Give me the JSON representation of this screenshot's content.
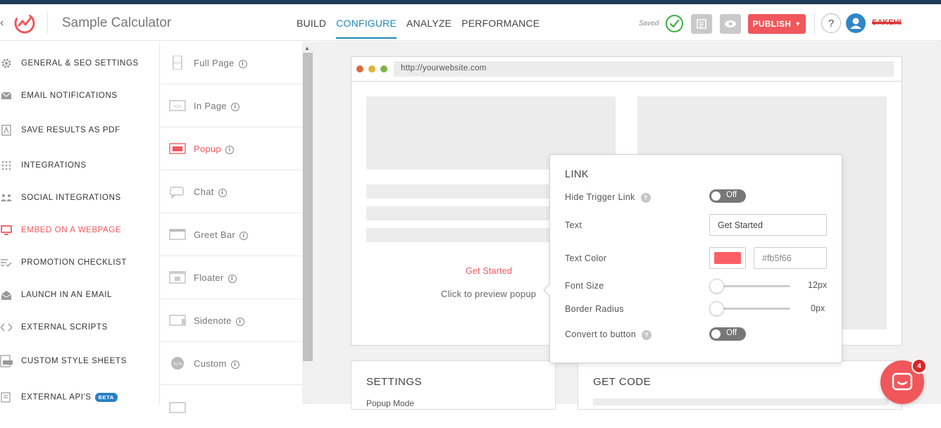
{
  "header": {
    "app_title": "Sample Calculator",
    "nav": [
      "BUILD",
      "CONFIGURE",
      "ANALYZE",
      "PERFORMANCE"
    ],
    "active_nav": "CONFIGURE",
    "saved_text": "Saved",
    "publish_label": "PUBLISH",
    "help_label": "?",
    "username": "SAKSHI"
  },
  "sidebar": {
    "items": [
      {
        "label": "GENERAL & SEO SETTINGS",
        "icon": "gear-icon"
      },
      {
        "label": "EMAIL NOTIFICATIONS",
        "icon": "envelope-icon"
      },
      {
        "label": "SAVE RESULTS AS PDF",
        "icon": "pdf-icon"
      },
      {
        "label": "INTEGRATIONS",
        "icon": "grid-dots-icon"
      },
      {
        "label": "SOCIAL INTEGRATIONS",
        "icon": "people-icon"
      },
      {
        "label": "EMBED ON A WEBPAGE",
        "icon": "monitor-icon"
      },
      {
        "label": "PROMOTION CHECKLIST",
        "icon": "checklist-icon"
      },
      {
        "label": "LAUNCH IN AN EMAIL",
        "icon": "open-envelope-icon"
      },
      {
        "label": "EXTERNAL SCRIPTS",
        "icon": "code-icon"
      },
      {
        "label": "CUSTOM STYLE SHEETS",
        "icon": "css-file-icon"
      },
      {
        "label": "EXTERNAL API'S",
        "icon": "api-icon",
        "badge": "BETA"
      }
    ],
    "active": "EMBED ON A WEBPAGE"
  },
  "embed_types": {
    "items": [
      "Full Page",
      "In Page",
      "Popup",
      "Chat",
      "Greet Bar",
      "Floater",
      "Sidenote",
      "Custom"
    ],
    "active": "Popup",
    "info_glyph": "i"
  },
  "preview": {
    "url": "http://yourwebsite.com",
    "link_text": "Get Started",
    "hint": "Click to preview popup"
  },
  "link_panel": {
    "title": "LINK",
    "hide_trigger_label": "Hide Trigger Link",
    "hide_trigger_state": "Off",
    "text_label": "Text",
    "text_value": "Get Started",
    "text_color_label": "Text Color",
    "text_color_value": "#fb5f66",
    "font_size_label": "Font Size",
    "font_size_value": "12px",
    "border_radius_label": "Border Radius",
    "border_radius_value": "0px",
    "convert_label": "Convert to button",
    "convert_state": "Off",
    "help_glyph": "?"
  },
  "settings_card": {
    "title": "SETTINGS",
    "sub": "Popup Mode"
  },
  "code_card": {
    "title": "GET CODE"
  },
  "chat": {
    "badge_count": "4"
  },
  "colors": {
    "accent": "#f0575b",
    "nav_active": "#1e8ab5",
    "saved_green": "#3cb043"
  }
}
